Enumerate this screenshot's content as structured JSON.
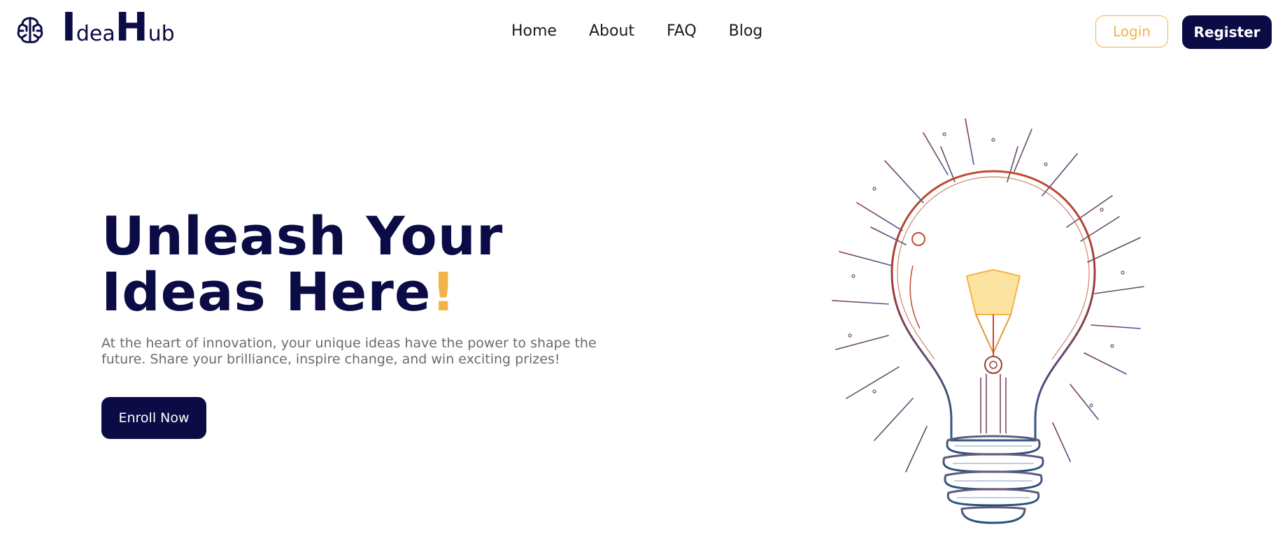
{
  "brand": {
    "logo_letter_1": "I",
    "logo_text_1": "dea",
    "logo_letter_2": "H",
    "logo_text_2": "ub",
    "icon": "brain-circuit-icon"
  },
  "nav": {
    "items": [
      "Home",
      "About",
      "FAQ",
      "Blog"
    ]
  },
  "auth": {
    "login_label": "Login",
    "register_label": "Register"
  },
  "hero": {
    "title_line1": "Unleash Your",
    "title_line2": "Ideas Here",
    "title_accent": "!",
    "description": "At the heart of innovation, your unique ideas have the power to shape the future. Share your brilliance, inspire change, and win exciting prizes!",
    "cta_label": "Enroll Now",
    "illustration": "lightbulb-illustration"
  },
  "colors": {
    "primary": "#0b0b45",
    "accent": "#f4b347",
    "text_muted": "#6b6b6b"
  }
}
